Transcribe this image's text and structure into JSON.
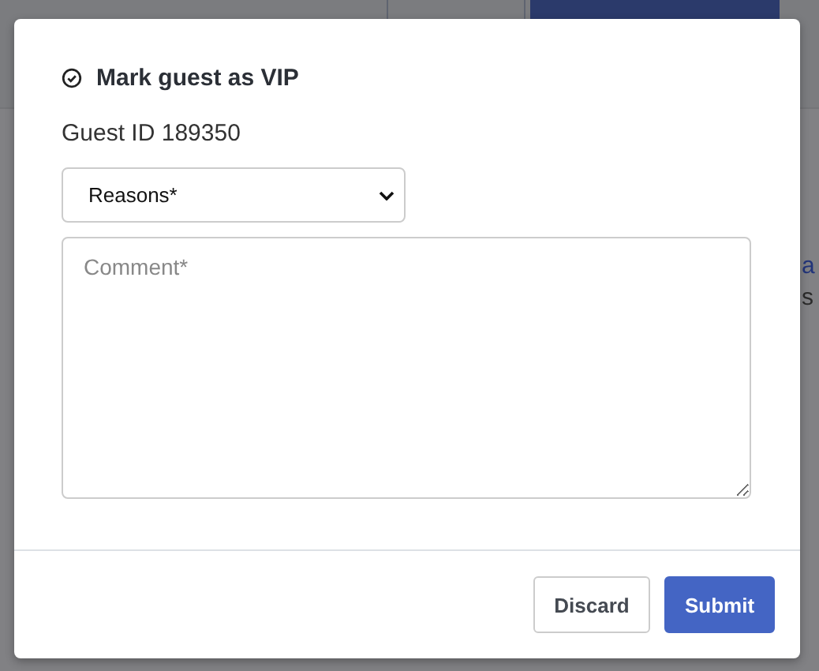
{
  "background": {
    "fragments": [
      {
        "text": "a",
        "kind": "link"
      },
      {
        "text": "s",
        "kind": "plain"
      }
    ]
  },
  "dialog": {
    "title": "Mark guest as VIP",
    "guest_id": "Guest ID 189350",
    "reasons": {
      "placeholder": "Reasons*"
    },
    "comment": {
      "placeholder": "Comment*"
    },
    "buttons": [
      {
        "label": "Discard",
        "kind": "secondary"
      },
      {
        "label": "Submit",
        "kind": "primary"
      }
    ]
  }
}
